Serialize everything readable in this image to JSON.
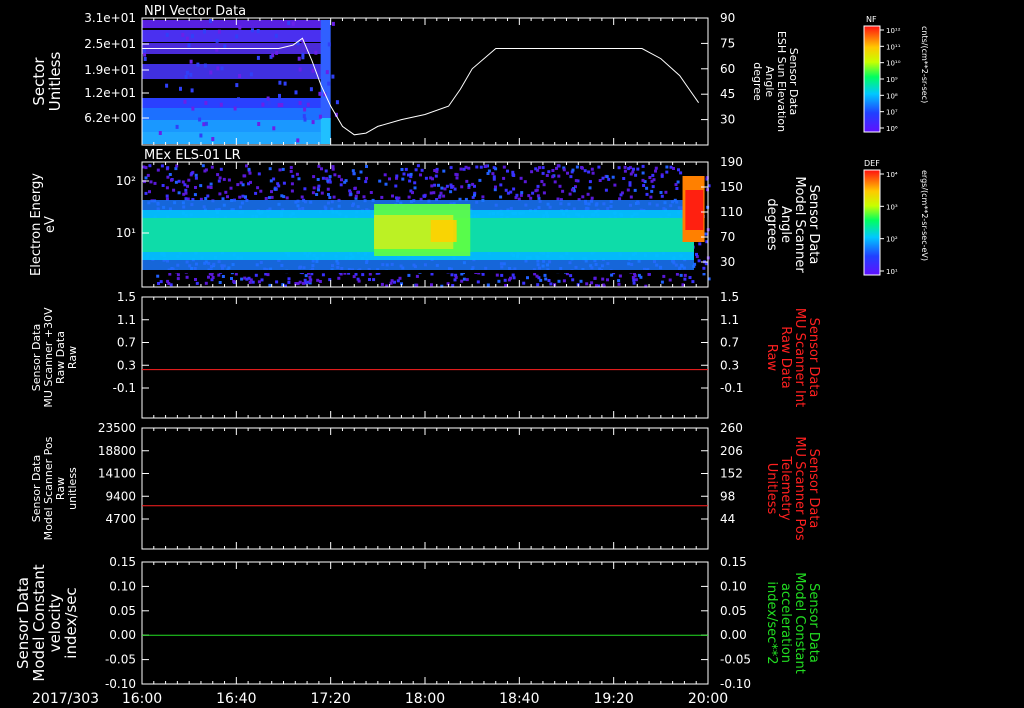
{
  "date_label": "2017/303",
  "x_ticks": [
    "16:00",
    "16:40",
    "17:20",
    "18:00",
    "18:40",
    "19:20",
    "20:00"
  ],
  "colors": {
    "white": "#ffffff",
    "red": "#ff2020",
    "green": "#22dd22",
    "background": "#000000"
  },
  "colorbars": [
    {
      "title": "NF",
      "units": "cnts/(cm**2-sr-sec)",
      "tick_labels": [
        "10¹²",
        "10¹¹",
        "10¹⁰",
        "10⁹",
        "10⁸",
        "10⁷",
        "10⁶"
      ]
    },
    {
      "title": "DEF",
      "units": "ergs/(cm**2-sr-sec-eV)",
      "tick_labels": [
        "10⁴",
        "10³",
        "10²",
        "10¹"
      ]
    }
  ],
  "chart_data": [
    {
      "type": "heatmap",
      "title": "NPI Vector Data",
      "ylabel": [
        "Sector",
        "Unitless"
      ],
      "y_tick_labels": [
        "3.1e+01",
        "2.5e+01",
        "1.9e+01",
        "1.2e+01",
        "6.2e+00"
      ],
      "right_label": [
        "Sensor Data",
        "ESH Sun Elevation",
        "Angle",
        "degree"
      ],
      "right_ticks": [
        90,
        75,
        60,
        45,
        30
      ],
      "right_ylim": [
        15,
        90
      ],
      "xlim": [
        0,
        240
      ],
      "heatmap_end_minute": 80,
      "overlay_series": {
        "name": "ESH Sun Elevation Angle",
        "x": [
          0,
          35,
          50,
          58,
          64,
          68,
          72,
          76,
          80,
          85,
          90,
          95,
          100,
          110,
          120,
          130,
          135,
          140,
          150,
          165,
          200,
          212,
          220,
          228,
          232,
          236
        ],
        "y": [
          72,
          72,
          72,
          72,
          74,
          78,
          65,
          50,
          38,
          26,
          21,
          22,
          26,
          30,
          33,
          38,
          48,
          60,
          72,
          72,
          72,
          72,
          66,
          56,
          48,
          40
        ]
      }
    },
    {
      "type": "heatmap",
      "title": "MEx ELS-01 LR",
      "ylabel": [
        "Electron Energy",
        "eV"
      ],
      "y_tick_labels": [
        "10²",
        "10¹"
      ],
      "right_label": [
        "Sensor Data",
        "Model Scanner",
        "Angle",
        "degrees"
      ],
      "right_ticks": [
        190,
        150,
        110,
        70,
        30
      ],
      "xlim": [
        0,
        240
      ]
    },
    {
      "type": "line",
      "ylabel": [
        "Sensor Data",
        "MU Scanner +30V",
        "Raw Data",
        "Raw"
      ],
      "y_tick_labels": [
        "1.5",
        "1.1",
        "0.7",
        "0.3",
        "-0.1"
      ],
      "right_label": [
        "Sensor Data",
        "MU Scanner Int",
        "Raw Data",
        "Raw"
      ],
      "right_tick_labels": [
        "1.5",
        "1.1",
        "0.7",
        "0.3",
        "-0.1"
      ],
      "ylim": [
        -0.5,
        1.5
      ],
      "xlim": [
        0,
        240
      ],
      "series": [
        {
          "x": [
            0,
            240
          ],
          "y": [
            0.3,
            0.3
          ],
          "color": "#ff2020"
        }
      ]
    },
    {
      "type": "line",
      "ylabel": [
        "Sensor Data",
        "Model Scanner Pos",
        "Raw",
        "unitless"
      ],
      "y_tick_labels": [
        "23500",
        "18800",
        "14100",
        "9400",
        "4700"
      ],
      "right_label": [
        "Sensor Data",
        "MU Scanner Pos",
        "Telemetry",
        "Unitless"
      ],
      "right_tick_labels": [
        "260",
        "206",
        "152",
        "98",
        "44"
      ],
      "ylim": [
        0,
        23500
      ],
      "xlim": [
        0,
        240
      ],
      "series": [
        {
          "x": [
            0,
            240
          ],
          "y": [
            8400,
            8400
          ],
          "color": "#ff2020"
        }
      ]
    },
    {
      "type": "line",
      "ylabel": [
        "Sensor Data",
        "Model Constant",
        "velocity",
        "index/sec"
      ],
      "y_tick_labels": [
        "0.15",
        "0.10",
        "0.05",
        "0.00",
        "-0.05",
        "-0.10"
      ],
      "right_label": [
        "Sensor Data",
        "Model Constant",
        "acceleration",
        "index/sec**2"
      ],
      "right_tick_labels": [
        "0.15",
        "0.10",
        "0.05",
        "0.00",
        "-0.05",
        "-0.10"
      ],
      "ylim": [
        -0.1,
        0.15
      ],
      "xlim": [
        0,
        240
      ],
      "series": [
        {
          "x": [
            0,
            240
          ],
          "y": [
            0,
            0
          ],
          "color": "#22dd22"
        }
      ]
    }
  ]
}
